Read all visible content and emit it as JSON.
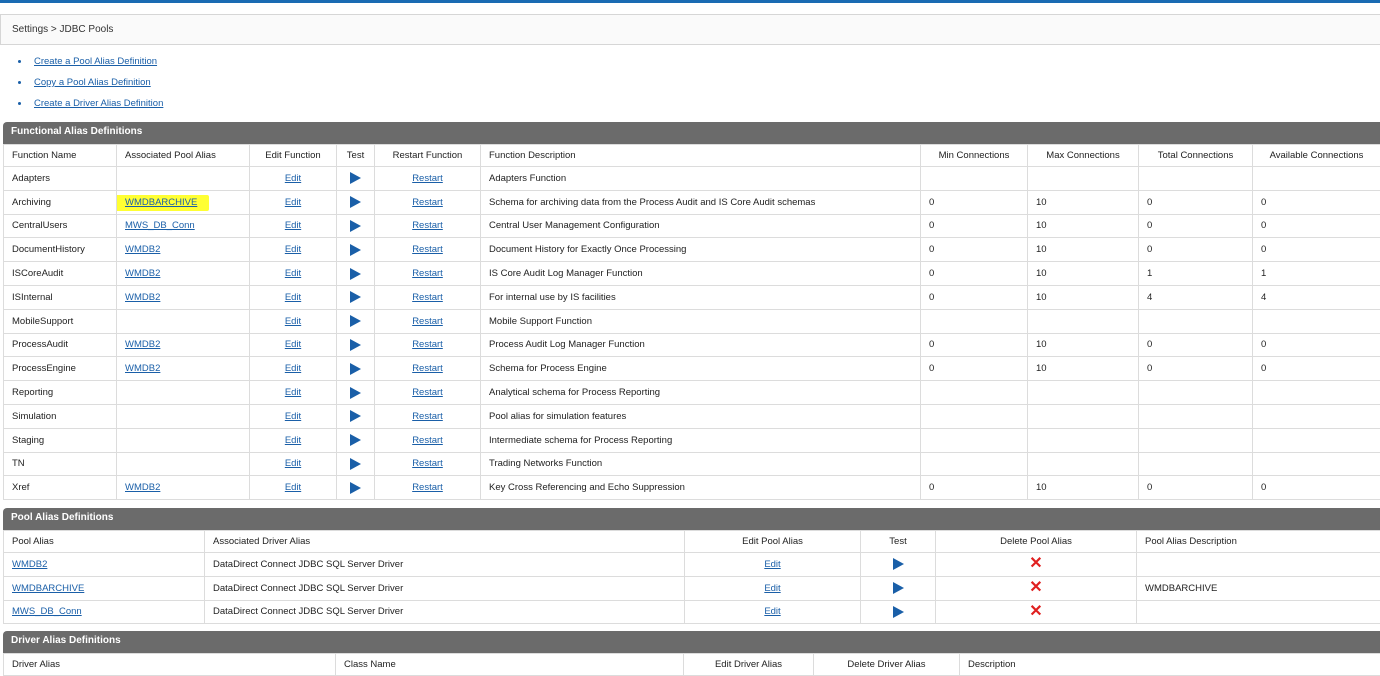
{
  "breadcrumb": "Settings > JDBC Pools",
  "links": [
    "Create a Pool Alias Definition",
    "Copy a Pool Alias Definition",
    "Create a Driver Alias Definition"
  ],
  "functional": {
    "title": "Functional Alias Definitions",
    "headers": [
      "Function Name",
      "Associated Pool Alias",
      "Edit Function",
      "Test",
      "Restart Function",
      "Function Description",
      "Min Connections",
      "Max Connections",
      "Total Connections",
      "Available Connections"
    ],
    "edit_label": "Edit",
    "restart_label": "Restart",
    "rows": [
      {
        "name": "Adapters",
        "pool": "",
        "desc": "Adapters Function",
        "min": "",
        "max": "",
        "total": "",
        "avail": ""
      },
      {
        "name": "Archiving",
        "pool": "WMDBARCHIVE",
        "desc": "Schema for archiving data from the Process Audit and IS Core Audit schemas",
        "min": "0",
        "max": "10",
        "total": "0",
        "avail": "0",
        "highlight": true
      },
      {
        "name": "CentralUsers",
        "pool": "MWS_DB_Conn",
        "desc": "Central User Management Configuration",
        "min": "0",
        "max": "10",
        "total": "0",
        "avail": "0"
      },
      {
        "name": "DocumentHistory",
        "pool": "WMDB2",
        "desc": "Document History for Exactly Once Processing",
        "min": "0",
        "max": "10",
        "total": "0",
        "avail": "0"
      },
      {
        "name": "ISCoreAudit",
        "pool": "WMDB2",
        "desc": "IS Core Audit Log Manager Function",
        "min": "0",
        "max": "10",
        "total": "1",
        "avail": "1"
      },
      {
        "name": "ISInternal",
        "pool": "WMDB2",
        "desc": "For internal use by IS facilities",
        "min": "0",
        "max": "10",
        "total": "4",
        "avail": "4"
      },
      {
        "name": "MobileSupport",
        "pool": "",
        "desc": "Mobile Support Function",
        "min": "",
        "max": "",
        "total": "",
        "avail": ""
      },
      {
        "name": "ProcessAudit",
        "pool": "WMDB2",
        "desc": "Process Audit Log Manager Function",
        "min": "0",
        "max": "10",
        "total": "0",
        "avail": "0"
      },
      {
        "name": "ProcessEngine",
        "pool": "WMDB2",
        "desc": "Schema for Process Engine",
        "min": "0",
        "max": "10",
        "total": "0",
        "avail": "0"
      },
      {
        "name": "Reporting",
        "pool": "",
        "desc": "Analytical schema for Process Reporting",
        "min": "",
        "max": "",
        "total": "",
        "avail": ""
      },
      {
        "name": "Simulation",
        "pool": "",
        "desc": "Pool alias for simulation features",
        "min": "",
        "max": "",
        "total": "",
        "avail": ""
      },
      {
        "name": "Staging",
        "pool": "",
        "desc": "Intermediate schema for Process Reporting",
        "min": "",
        "max": "",
        "total": "",
        "avail": ""
      },
      {
        "name": "TN",
        "pool": "",
        "desc": "Trading Networks Function",
        "min": "",
        "max": "",
        "total": "",
        "avail": ""
      },
      {
        "name": "Xref",
        "pool": "WMDB2",
        "desc": "Key Cross Referencing and Echo Suppression",
        "min": "0",
        "max": "10",
        "total": "0",
        "avail": "0"
      }
    ]
  },
  "pool": {
    "title": "Pool Alias Definitions",
    "headers": [
      "Pool Alias",
      "Associated Driver Alias",
      "Edit Pool Alias",
      "Test",
      "Delete Pool Alias",
      "Pool Alias Description"
    ],
    "edit_label": "Edit",
    "rows": [
      {
        "alias": "WMDB2",
        "driver": "DataDirect Connect JDBC SQL Server Driver",
        "desc": ""
      },
      {
        "alias": "WMDBARCHIVE",
        "driver": "DataDirect Connect JDBC SQL Server Driver",
        "desc": "WMDBARCHIVE"
      },
      {
        "alias": "MWS_DB_Conn",
        "driver": "DataDirect Connect JDBC SQL Server Driver",
        "desc": ""
      }
    ]
  },
  "driver": {
    "title": "Driver Alias Definitions",
    "headers": [
      "Driver Alias",
      "Class Name",
      "Edit Driver Alias",
      "Delete Driver Alias",
      "Description"
    ]
  },
  "colors": {
    "accent": "#1a5fa8",
    "header_bg": "#6b6b6b",
    "highlight": "#ffff33",
    "delete": "#e02020"
  }
}
